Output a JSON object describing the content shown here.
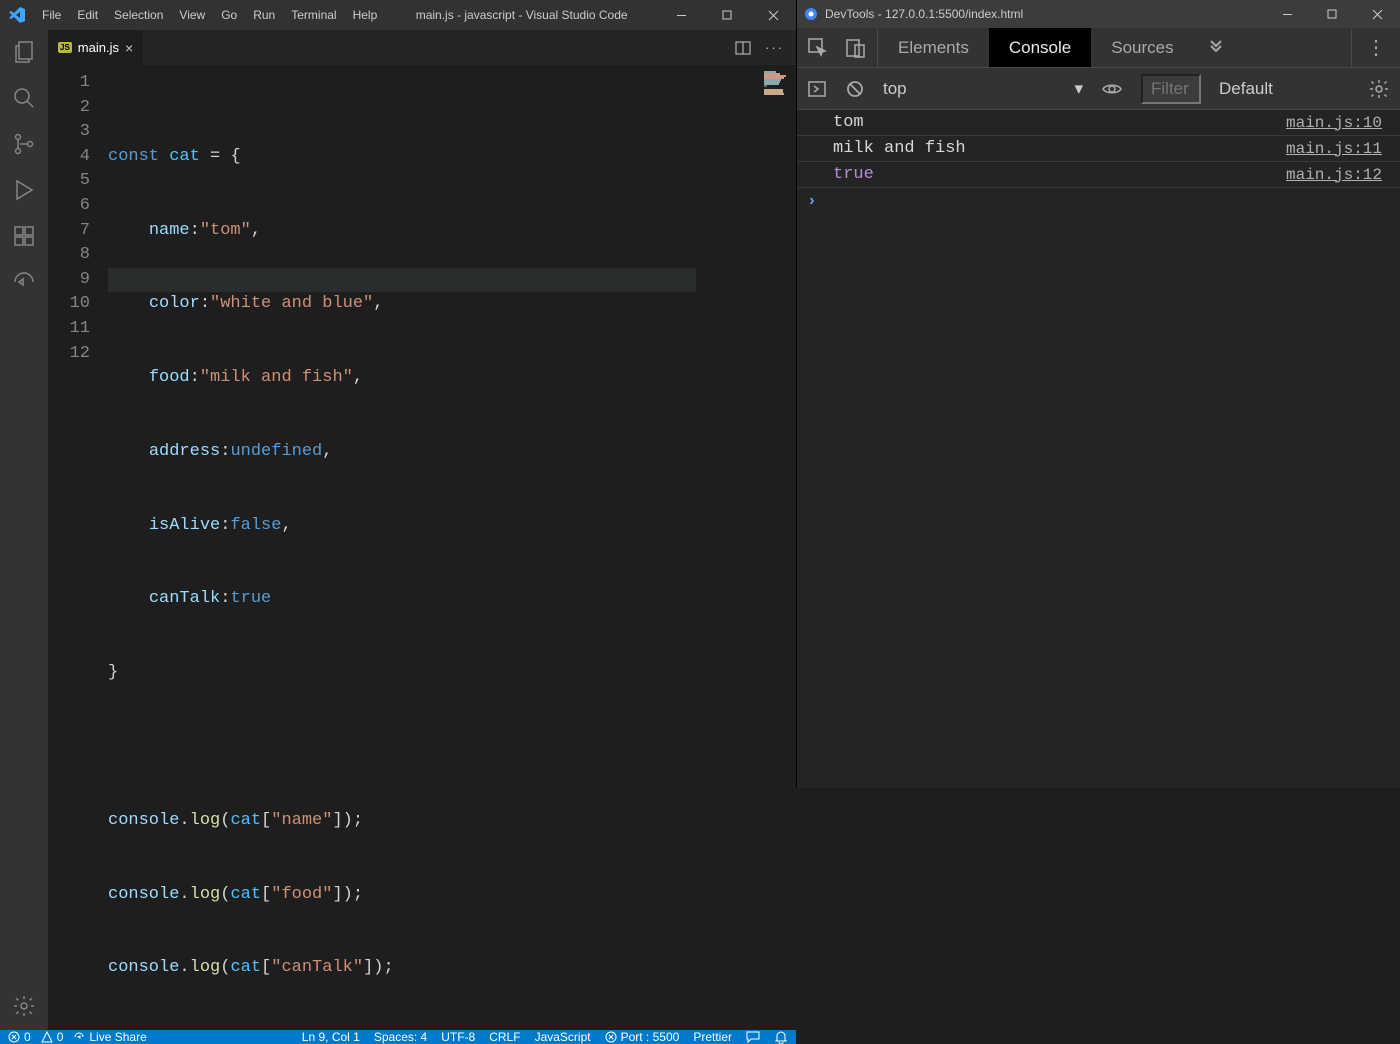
{
  "vscode": {
    "title": "main.js - javascript - Visual Studio Code",
    "menu": [
      "File",
      "Edit",
      "Selection",
      "View",
      "Go",
      "Run",
      "Terminal",
      "Help"
    ],
    "tab": {
      "filename": "main.js"
    },
    "gutter": [
      "1",
      "2",
      "3",
      "4",
      "5",
      "6",
      "7",
      "8",
      "9",
      "10",
      "11",
      "12"
    ],
    "code": {
      "l1": {
        "kw": "const",
        "var": "cat",
        "eq": " = ",
        "brace": "{"
      },
      "l2": {
        "prop": "name",
        "colon": ":",
        "str": "\"tom\"",
        "comma": ","
      },
      "l3": {
        "prop": "color",
        "colon": ":",
        "str": "\"white and blue\"",
        "comma": ","
      },
      "l4": {
        "prop": "food",
        "colon": ":",
        "str": "\"milk and fish\"",
        "comma": ","
      },
      "l5": {
        "prop": "address",
        "colon": ":",
        "val": "undefined",
        "comma": ","
      },
      "l6": {
        "prop": "isAlive",
        "colon": ":",
        "val": "false",
        "comma": ","
      },
      "l7": {
        "prop": "canTalk",
        "colon": ":",
        "val": "true"
      },
      "l8": {
        "brace": "}"
      },
      "l10": {
        "obj": "console",
        "dot": ".",
        "fn": "log",
        "open": "(",
        "var": "cat",
        "lb": "[",
        "str": "\"name\"",
        "rb": "]",
        "close": ");"
      },
      "l11": {
        "obj": "console",
        "dot": ".",
        "fn": "log",
        "open": "(",
        "var": "cat",
        "lb": "[",
        "str": "\"food\"",
        "rb": "]",
        "close": ");"
      },
      "l12": {
        "obj": "console",
        "dot": ".",
        "fn": "log",
        "open": "(",
        "var": "cat",
        "lb": "[",
        "str": "\"canTalk\"",
        "rb": "]",
        "close": ");"
      }
    },
    "statusbar": {
      "errors": "0",
      "warnings": "0",
      "liveshare": "Live Share",
      "cursor": "Ln 9, Col 1",
      "spaces": "Spaces: 4",
      "encoding": "UTF-8",
      "eol": "CRLF",
      "language": "JavaScript",
      "port": "Port : 5500",
      "prettier": "Prettier"
    }
  },
  "devtools": {
    "title": "DevTools - 127.0.0.1:5500/index.html",
    "tabs": {
      "elements": "Elements",
      "console": "Console",
      "sources": "Sources"
    },
    "toolbar": {
      "context": "top",
      "filter_ph": "Filter",
      "levels": "Default"
    },
    "console": [
      {
        "msg": "tom",
        "src": "main.js:10",
        "kind": "text"
      },
      {
        "msg": "milk and fish",
        "src": "main.js:11",
        "kind": "text"
      },
      {
        "msg": "true",
        "src": "main.js:12",
        "kind": "bool"
      }
    ]
  }
}
